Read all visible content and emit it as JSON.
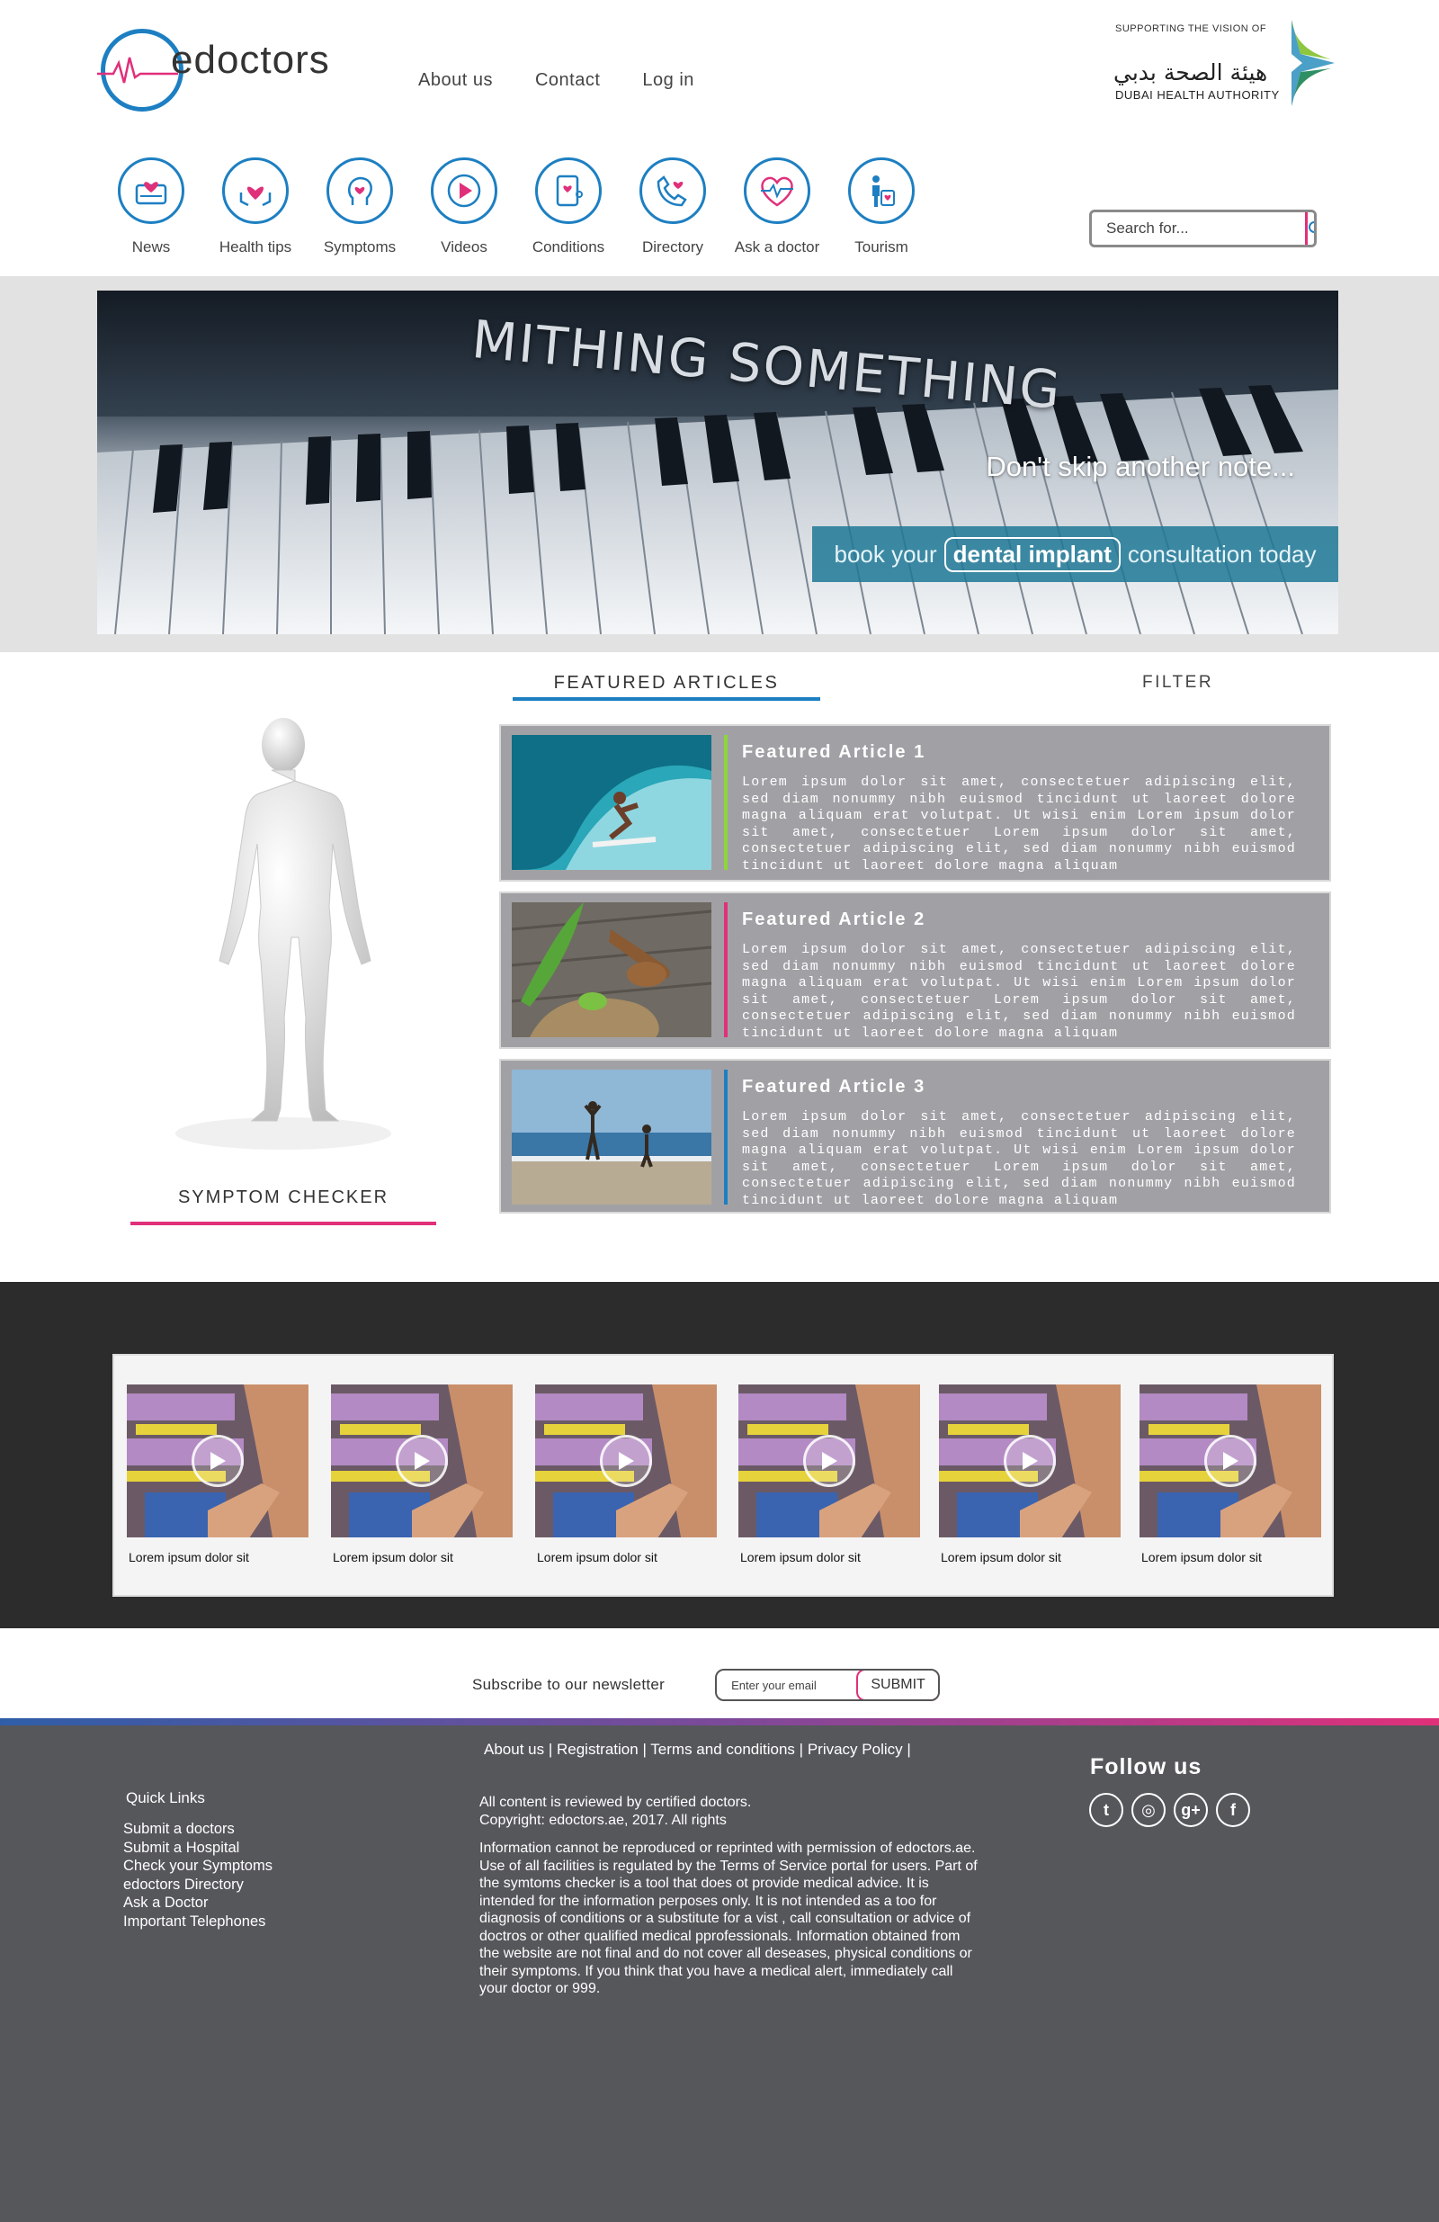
{
  "brand": {
    "name": "edoctors"
  },
  "topnav": [
    "About us",
    "Contact",
    "Log in"
  ],
  "partner": {
    "tagline": "SUPPORTING THE VISION OF",
    "arabic": "هيئة الصحة بدبي",
    "name": "DUBAI HEALTH AUTHORITY"
  },
  "categories": [
    {
      "label": "News",
      "icon": "news-icon"
    },
    {
      "label": "Health tips",
      "icon": "health-tips-icon"
    },
    {
      "label": "Symptoms",
      "icon": "symptoms-icon"
    },
    {
      "label": "Videos",
      "icon": "video-play-icon"
    },
    {
      "label": "Conditions",
      "icon": "conditions-icon"
    },
    {
      "label": "Directory",
      "icon": "directory-phone-icon"
    },
    {
      "label": "Ask a doctor",
      "icon": "heartbeat-icon"
    },
    {
      "label": "Tourism",
      "icon": "tourism-icon"
    }
  ],
  "search": {
    "placeholder": "Search for..."
  },
  "hero": {
    "title": "MITHING SOMETHING",
    "tagline": "Don't skip another note...",
    "cta_pre": "book your",
    "cta_highlight": "dental implant",
    "cta_post": "consultation today"
  },
  "featured": {
    "tab": "FEATURED ARTICLES",
    "filter": "FILTER",
    "articles": [
      {
        "title": "Featured Article 1",
        "accent": "#8ed63a",
        "text": "Lorem ipsum dolor sit amet, consectetuer adipiscing elit, sed diam nonummy nibh euismod tincidunt ut laoreet dolore magna aliquam erat volutpat. Ut wisi enim Lorem ipsum dolor sit amet, consectetuer Lorem ipsum dolor sit amet, consectetuer adipiscing elit, sed diam nonummy nibh euismod tincidunt ut laoreet dolore magna aliquam"
      },
      {
        "title": "Featured Article 2",
        "accent": "#e0307a",
        "text": "Lorem ipsum dolor sit amet, consectetuer adipiscing elit, sed diam nonummy nibh euismod tincidunt ut laoreet dolore magna aliquam erat volutpat. Ut wisi enim Lorem ipsum dolor sit amet, consectetuer Lorem ipsum dolor sit amet, consectetuer adipiscing elit, sed diam nonummy nibh euismod tincidunt ut laoreet dolore magna aliquam"
      },
      {
        "title": "Featured Article 3",
        "accent": "#1d7fc2",
        "text": "Lorem ipsum dolor sit amet, consectetuer adipiscing elit, sed diam nonummy nibh euismod tincidunt ut laoreet dolore magna aliquam erat volutpat. Ut wisi enim Lorem ipsum dolor sit amet, consectetuer Lorem ipsum dolor sit amet, consectetuer adipiscing elit, sed diam nonummy nibh euismod tincidunt ut laoreet dolore magna aliquam"
      }
    ]
  },
  "symptom_checker": {
    "label": "SYMPTOM CHECKER"
  },
  "videos": [
    {
      "caption": "Lorem ipsum dolor sit"
    },
    {
      "caption": "Lorem ipsum dolor sit"
    },
    {
      "caption": "Lorem ipsum dolor sit"
    },
    {
      "caption": "Lorem ipsum dolor sit"
    },
    {
      "caption": "Lorem ipsum dolor sit"
    },
    {
      "caption": "Lorem ipsum dolor sit"
    }
  ],
  "newsletter": {
    "label": "Subscribe to our newsletter",
    "placeholder": "Enter your email",
    "submit": "SUBMIT"
  },
  "footer": {
    "links": [
      "About us",
      "Registration",
      "Terms and conditions",
      "Privacy Policy"
    ],
    "separator": "|",
    "quick_links_title": "Quick Links",
    "quick_links": [
      "Submit a doctors",
      "Submit a Hospital",
      "Check your Symptoms",
      "edoctors Directory",
      "Ask a Doctor",
      "Important Telephones"
    ],
    "para1": "All content is reviewed by certified doctors.\nCopyright: edoctors.ae, 2017. All rights",
    "para2": "Information cannot be reproduced or reprinted with permission of edoctors.ae.\nUse of all facilities is regulated by the Terms of Service portal for users. Part of the symtoms checker is a tool that does ot provide medical advice. It is intended for the information perposes only. It is not intended as a too for diagnosis of conditions or a substitute for a vist , call consultation or advice of doctros or other qualified medical pprofessionals. Information obtained from the website are not final and do not cover all deseases, physical conditions or their symptoms. If you think that you have a medical alert, immediately call your doctor or 999.",
    "follow": "Follow us",
    "socials": [
      {
        "icon": "twitter-icon",
        "glyph": "t"
      },
      {
        "icon": "instagram-icon",
        "glyph": "◎"
      },
      {
        "icon": "google-plus-icon",
        "glyph": "g+"
      },
      {
        "icon": "facebook-icon",
        "glyph": "f"
      }
    ]
  },
  "colors": {
    "blue": "#1d7fc2",
    "pink": "#e0307a",
    "green": "#8ed63a",
    "footer_bg": "#56575b",
    "video_band": "#2c2c2c"
  }
}
